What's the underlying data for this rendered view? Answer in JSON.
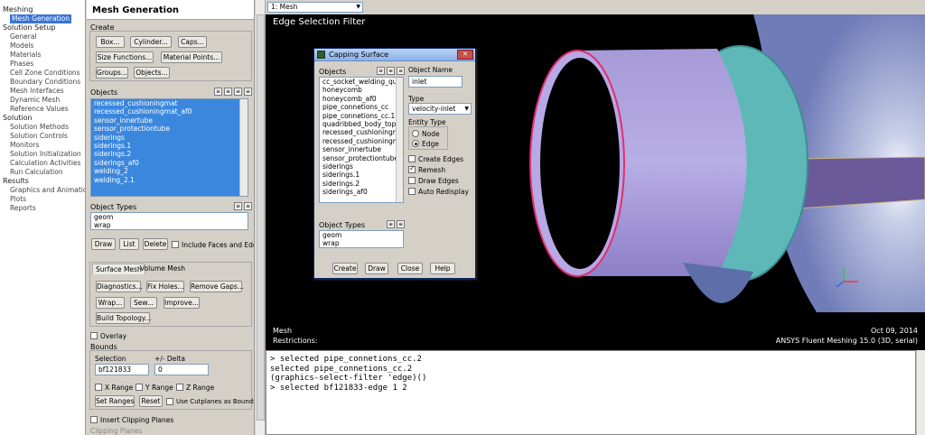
{
  "nav": {
    "meshing": "Meshing",
    "mesh_generation": "Mesh Generation",
    "solution_setup": "Solution Setup",
    "setup_items": [
      "General",
      "Models",
      "Materials",
      "Phases",
      "Cell Zone Conditions",
      "Boundary Conditions",
      "Mesh Interfaces",
      "Dynamic Mesh",
      "Reference Values"
    ],
    "solution": "Solution",
    "solution_items": [
      "Solution Methods",
      "Solution Controls",
      "Monitors",
      "Solution Initialization",
      "Calculation Activities",
      "Run Calculation"
    ],
    "results": "Results",
    "results_items": [
      "Graphics and Animations",
      "Plots",
      "Reports"
    ]
  },
  "panel": {
    "title": "Mesh Generation",
    "create_label": "Create",
    "buttons": {
      "box": "Box...",
      "cylinder": "Cylinder...",
      "caps": "Caps...",
      "size_functions": "Size Functions...",
      "material_points": "Material Points...",
      "groups": "Groups...",
      "objects": "Objects..."
    },
    "objects_label": "Objects",
    "objects_list": [
      "recessed_cushioningmat",
      "recessed_cushioningmat_af0",
      "sensor_innertube",
      "sensor_protectiontube",
      "siderings",
      "siderings.1",
      "siderings.2",
      "siderings_af0",
      "welding_2",
      "welding_2.1"
    ],
    "object_types_label": "Object Types",
    "object_types": [
      "geom",
      "wrap"
    ],
    "draw": "Draw",
    "list": "List",
    "delete": "Delete",
    "include_faces_edges": "Include Faces and Edges",
    "tab_surface_mesh": "Surface Mesh",
    "tab_volume_mesh": "Volume Mesh",
    "diagnostics": "Diagnostics...",
    "fix_holes": "Fix Holes...",
    "remove_gaps": "Remove Gaps...",
    "wrap": "Wrap...",
    "sew": "Sew...",
    "improve": "Improve...",
    "build_topology": "Build Topology...",
    "overlay": "Overlay",
    "bounds": "Bounds",
    "selection_label": "Selection",
    "delta_label": "+/- Delta",
    "selection_value": "bf121833",
    "delta_value": "0",
    "x_range": "X Range",
    "y_range": "Y Range",
    "z_range": "Z Range",
    "set_ranges": "Set Ranges",
    "reset": "Reset",
    "use_cutplanes": "Use Cutplanes as Bounds?",
    "insert_clipping": "Insert Clipping Planes",
    "clipping_planes": "Clipping Planes"
  },
  "graphics": {
    "view_combo": "1: Mesh",
    "title": "Edge Selection Filter",
    "footer_left_1": "Mesh",
    "footer_left_2": "Restrictions:",
    "footer_date": "Oct 09, 2014",
    "footer_product": "ANSYS Fluent Meshing 15.0 (3D, serial)"
  },
  "dialog": {
    "title": "Capping Surface",
    "objects_label": "Objects",
    "objects_list": [
      "cc_socket_welding_quilt_",
      "honeycomb",
      "honeycomb_af0",
      "pipe_connetions_cc",
      "pipe_connetions_cc.1",
      "quadribbed_body_top_a",
      "recessed_cushioningmat",
      "recessed_cushioningmat_",
      "sensor_innertube",
      "sensor_protectiontube",
      "siderings",
      "siderings.1",
      "siderings.2",
      "siderings_af0"
    ],
    "object_name_label": "Object Name",
    "object_name_value": "inlet",
    "type_label": "Type",
    "type_value": "velocity-inlet",
    "entity_type_label": "Entity Type",
    "node": "Node",
    "edge": "Edge",
    "create_edges": "Create Edges",
    "remesh": "Remesh",
    "draw_edges": "Draw Edges",
    "auto_redisplay": "Auto Redisplay",
    "object_types_label": "Object Types",
    "object_types": [
      "geom",
      "wrap"
    ],
    "create": "Create",
    "draw": "Draw",
    "close": "Close",
    "help": "Help"
  },
  "console": {
    "lines": [
      "> selected pipe_connetions_cc.2",
      "selected pipe_connetions_cc.2",
      "(graphics-select-filter 'edge)()",
      "",
      "",
      "> selected bf121833-edge 1 2"
    ]
  }
}
